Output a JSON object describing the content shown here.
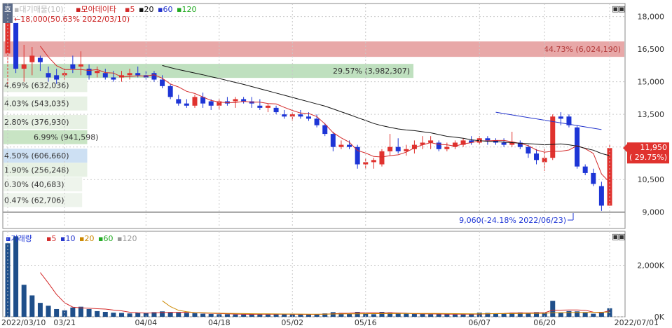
{
  "price_panel": {
    "legend": {
      "title": "▪대기매물(10)",
      "stock": "▪모아데이타",
      "ma_labels": [
        "▪5",
        "▪20",
        "▪60",
        "▪120"
      ],
      "ma_colors": [
        "#d42a2a",
        "#111111",
        "#2233cc",
        "#22aa22"
      ]
    },
    "high_marker": "18,000(50.63% 2022/03/10)",
    "low_marker": "9,060(-24.18% 2022/06/23)",
    "current_price": "11,950",
    "current_change": "( 29.75%)",
    "button_a": "▣",
    "button_b": "▣",
    "buy_sell_tab": "호"
  },
  "volume_panel": {
    "legend": {
      "title": "▪거래량",
      "ma_labels": [
        "▪5",
        "▪10",
        "▪20",
        "▪60",
        "▪120"
      ],
      "ma_colors": [
        "#d42a2a",
        "#2233cc",
        "#cc8800",
        "#22aa22",
        "#999999"
      ]
    },
    "button_a": "▣",
    "button_b": "▣"
  },
  "chart_data": {
    "type": "candlestick",
    "price_axis": {
      "ticks": [
        18000,
        16500,
        15000,
        13500,
        12000,
        10500,
        9000
      ],
      "tick_labels": [
        "18,000",
        "16,500",
        "15,000",
        "13,500",
        "12,000",
        "10,500",
        "9,000"
      ],
      "range": [
        8250,
        18600
      ]
    },
    "volume_axis": {
      "ticks": [
        0,
        2000000
      ],
      "tick_labels": [
        "0K",
        "2,000K"
      ],
      "range": [
        0,
        3100000
      ]
    },
    "x_tick_labels": [
      "2022/03/10",
      "03/21",
      "04/04",
      "04/18",
      "05/02",
      "05/16",
      "06/07",
      "06/20",
      "2022/07/01"
    ],
    "x_tick_index": [
      0,
      7,
      17,
      26,
      35,
      44,
      58,
      66,
      74
    ],
    "candles": [
      [
        16300,
        18000,
        14800,
        17700,
        2850000
      ],
      [
        17700,
        17700,
        15400,
        15600,
        3120000
      ],
      [
        15600,
        16700,
        15000,
        15800,
        1240000
      ],
      [
        15900,
        16600,
        15300,
        16200,
        830000
      ],
      [
        16100,
        16200,
        15500,
        15900,
        540000
      ],
      [
        15400,
        15700,
        15000,
        15200,
        430000
      ],
      [
        15300,
        15600,
        14900,
        15100,
        300000
      ],
      [
        15300,
        15600,
        15100,
        15400,
        250000
      ],
      [
        15800,
        16200,
        15400,
        15600,
        360000
      ],
      [
        15700,
        16400,
        15300,
        15800,
        390000
      ],
      [
        15600,
        15800,
        15100,
        15300,
        300000
      ],
      [
        15400,
        15700,
        15200,
        15500,
        220000
      ],
      [
        15400,
        15600,
        15100,
        15200,
        190000
      ],
      [
        15200,
        15500,
        15000,
        15100,
        160000
      ],
      [
        15200,
        15500,
        15000,
        15300,
        150000
      ],
      [
        15300,
        15600,
        15100,
        15400,
        130000
      ],
      [
        15400,
        15700,
        15200,
        15300,
        150000
      ],
      [
        15300,
        15500,
        15100,
        15200,
        140000
      ],
      [
        15400,
        15500,
        15000,
        15100,
        180000
      ],
      [
        15100,
        15300,
        14700,
        14800,
        210000
      ],
      [
        14800,
        14900,
        14200,
        14300,
        170000
      ],
      [
        14200,
        14400,
        13900,
        14000,
        160000
      ],
      [
        14000,
        14200,
        13800,
        13900,
        150000
      ],
      [
        13900,
        14400,
        13800,
        14300,
        140000
      ],
      [
        14300,
        14500,
        13800,
        14000,
        120000
      ],
      [
        14100,
        14200,
        13700,
        13900,
        110000
      ],
      [
        13900,
        14200,
        13700,
        14100,
        100000
      ],
      [
        14100,
        14300,
        13900,
        14000,
        100000
      ],
      [
        14100,
        14300,
        13800,
        14200,
        90000
      ],
      [
        14200,
        14300,
        14000,
        14100,
        90000
      ],
      [
        14100,
        14300,
        13800,
        14000,
        110000
      ],
      [
        13900,
        14200,
        13700,
        13800,
        100000
      ],
      [
        13800,
        14000,
        13600,
        13900,
        90000
      ],
      [
        13800,
        13900,
        13500,
        13600,
        100000
      ],
      [
        13500,
        13700,
        13300,
        13400,
        100000
      ],
      [
        13400,
        13600,
        13200,
        13500,
        90000
      ],
      [
        13500,
        13700,
        13300,
        13400,
        80000
      ],
      [
        13400,
        13600,
        13200,
        13300,
        80000
      ],
      [
        13300,
        13500,
        12900,
        13000,
        100000
      ],
      [
        13000,
        13100,
        12500,
        12600,
        130000
      ],
      [
        12600,
        12700,
        11800,
        12000,
        180000
      ],
      [
        12000,
        12300,
        11900,
        12100,
        150000
      ],
      [
        12100,
        12300,
        11900,
        12000,
        110000
      ],
      [
        12000,
        12100,
        11000,
        11200,
        190000
      ],
      [
        11200,
        11500,
        11000,
        11300,
        130000
      ],
      [
        11300,
        11500,
        11000,
        11400,
        100000
      ],
      [
        11200,
        11900,
        11100,
        11800,
        190000
      ],
      [
        11800,
        12600,
        11600,
        12000,
        170000
      ],
      [
        12000,
        12400,
        11700,
        11800,
        140000
      ],
      [
        11800,
        12100,
        11600,
        11900,
        120000
      ],
      [
        11900,
        12300,
        11700,
        12100,
        110000
      ],
      [
        12100,
        12500,
        11900,
        12200,
        110000
      ],
      [
        12200,
        12500,
        11900,
        12300,
        100000
      ],
      [
        12200,
        12300,
        11800,
        11900,
        120000
      ],
      [
        11900,
        12200,
        11800,
        12000,
        100000
      ],
      [
        12000,
        12300,
        11900,
        12200,
        90000
      ],
      [
        12100,
        12400,
        12000,
        12300,
        90000
      ],
      [
        12300,
        12500,
        12100,
        12200,
        100000
      ],
      [
        12200,
        12500,
        12100,
        12400,
        160000
      ],
      [
        12400,
        12500,
        12100,
        12300,
        150000
      ],
      [
        12300,
        12400,
        12100,
        12200,
        130000
      ],
      [
        12200,
        12400,
        12000,
        12100,
        120000
      ],
      [
        12100,
        12700,
        12000,
        12200,
        160000
      ],
      [
        12200,
        12300,
        11900,
        12000,
        170000
      ],
      [
        12000,
        12100,
        11500,
        11700,
        160000
      ],
      [
        11700,
        11900,
        11200,
        11400,
        180000
      ],
      [
        11300,
        11900,
        10900,
        11500,
        160000
      ],
      [
        11500,
        13500,
        11400,
        13400,
        620000
      ],
      [
        13400,
        13600,
        13000,
        13300,
        160000
      ],
      [
        13400,
        13500,
        12900,
        13000,
        220000
      ],
      [
        12900,
        13000,
        11000,
        11100,
        210000
      ],
      [
        11100,
        11200,
        10700,
        10800,
        160000
      ],
      [
        10800,
        11000,
        10200,
        10300,
        120000
      ],
      [
        10200,
        10400,
        9060,
        9300,
        160000
      ],
      [
        9300,
        12100,
        9300,
        11950,
        330000
      ]
    ],
    "ma_values": {
      "ma5": [
        null,
        null,
        null,
        null,
        16640,
        16140,
        15740,
        15560,
        15560,
        15560,
        15520,
        15560,
        15420,
        15400,
        15220,
        15240,
        15280,
        15260,
        15320,
        15160,
        14900,
        14760,
        14560,
        14460,
        14300,
        14140,
        14060,
        14040,
        14040,
        14100,
        14060,
        14060,
        14000,
        13980,
        13820,
        13680,
        13560,
        13540,
        13400,
        13060,
        12660,
        12420,
        12220,
        11840,
        11720,
        11560,
        11540,
        11600,
        11640,
        11760,
        11960,
        12100,
        12200,
        12120,
        12100,
        12040,
        12140,
        12200,
        12280,
        12280,
        12300,
        12300,
        12240,
        12160,
        12060,
        11860,
        11760,
        11800,
        11800,
        11860,
        12060,
        11920,
        11700,
        10760,
        10370
      ],
      "ma20": [
        null,
        null,
        null,
        null,
        null,
        null,
        null,
        null,
        null,
        null,
        null,
        null,
        null,
        null,
        null,
        null,
        null,
        null,
        null,
        15750,
        15650,
        15560,
        15480,
        15400,
        15320,
        15230,
        15150,
        15060,
        14970,
        14880,
        14780,
        14680,
        14580,
        14480,
        14380,
        14280,
        14180,
        14080,
        13980,
        13880,
        13750,
        13620,
        13490,
        13350,
        13220,
        13080,
        12980,
        12900,
        12830,
        12780,
        12750,
        12700,
        12650,
        12570,
        12490,
        12450,
        12400,
        12330,
        12290,
        12260,
        12250,
        12220,
        12200,
        12170,
        12150,
        12130,
        12100,
        12120,
        12140,
        12100,
        12040,
        11940,
        11850,
        11700,
        11600
      ],
      "ma60_start_index": 61,
      "ma60": [
        13500,
        13420,
        13340,
        13260,
        13180,
        13100,
        13020,
        12940,
        12860,
        12780,
        12700,
        12620,
        12540,
        12460
      ],
      "ma120": []
    },
    "volume_bars_color": "#1f4f8a",
    "volume_ma5": [
      null,
      null,
      null,
      null,
      1718000,
      1308000,
      868000,
      542000,
      376000,
      346000,
      332000,
      312000,
      300000,
      262000,
      230000,
      178000,
      158000,
      148000,
      150000,
      166000,
      174000,
      174000,
      178000,
      166000,
      148000,
      136000,
      124000,
      116000,
      106000,
      98000,
      96000,
      98000,
      98000,
      98000,
      100000,
      98000,
      94000,
      92000,
      94000,
      102000,
      118000,
      132000,
      138000,
      154000,
      156000,
      154000,
      146000,
      158000,
      146000,
      140000,
      120000,
      114000,
      112000,
      110000,
      104000,
      104000,
      102000,
      100000,
      106000,
      118000,
      126000,
      130000,
      146000,
      150000,
      150000,
      156000,
      158000,
      258000,
      258000,
      266000,
      266000,
      254000,
      180000,
      158000,
      240000
    ],
    "volume_ma20": [
      null,
      null,
      null,
      null,
      null,
      null,
      null,
      null,
      null,
      null,
      null,
      null,
      null,
      null,
      null,
      null,
      null,
      null,
      null,
      620000,
      395000,
      250000,
      196000,
      164000,
      154000,
      146000,
      140000,
      134000,
      128000,
      124000,
      120000,
      116000,
      114000,
      112000,
      110000,
      108000,
      106000,
      104000,
      104000,
      104000,
      108000,
      112000,
      114000,
      118000,
      120000,
      122000,
      124000,
      126000,
      128000,
      130000,
      130000,
      130000,
      130000,
      128000,
      126000,
      122000,
      120000,
      118000,
      118000,
      120000,
      122000,
      124000,
      126000,
      130000,
      132000,
      134000,
      136000,
      154000,
      160000,
      166000,
      170000,
      172000,
      174000,
      176000,
      182000
    ]
  },
  "price_levels": [
    {
      "label": "44.73% (6,024,190)",
      "price": 16500,
      "band_color": "#e8a8a8",
      "align": "right"
    },
    {
      "label": "29.57% (3,982,307)",
      "price": 15500,
      "band_color": "#bfe0bf",
      "align": "left"
    },
    {
      "label": "4.69% (632,036)",
      "price": 14850,
      "band_color": "#e7f1e4",
      "align": "left"
    },
    {
      "label": "4.03% (543,035)",
      "price": 14000,
      "band_color": "#e7f1e4",
      "align": "left"
    },
    {
      "label": "2.80% (376,930)",
      "price": 13150,
      "band_color": "#e7f1e4",
      "align": "left"
    },
    {
      "label": "6.99% (941,598)",
      "price": 12450,
      "band_color": "#c8e4c4",
      "align": "left"
    },
    {
      "label": "4.50% (606,660)",
      "price": 11600,
      "band_color": "#cde0f3",
      "align": "left"
    },
    {
      "label": "1.90% (256,248)",
      "price": 10950,
      "band_color": "#e7f1e4",
      "align": "left"
    },
    {
      "label": "0.30% (40,683)",
      "price": 10280,
      "band_color": "#eef4ec",
      "align": "left"
    },
    {
      "label": "0.47% (62,706)",
      "price": 9560,
      "band_color": "#eef4ec",
      "align": "left"
    }
  ],
  "trend_line": {
    "from": [
      60,
      13600
    ],
    "to": [
      73,
      12800
    ],
    "color": "#2233cc"
  },
  "colors": {
    "up": "#e0322e",
    "down": "#1d35d6",
    "grid": "#c9c9c9",
    "axis_text": "#333333",
    "current_badge_bg": "#e0322e",
    "current_badge_text": "#ffffff",
    "high_text": "#cc2222",
    "low_text": "#1d35d6",
    "level_text_red": "#b33a3a",
    "level_text": "#333333"
  }
}
